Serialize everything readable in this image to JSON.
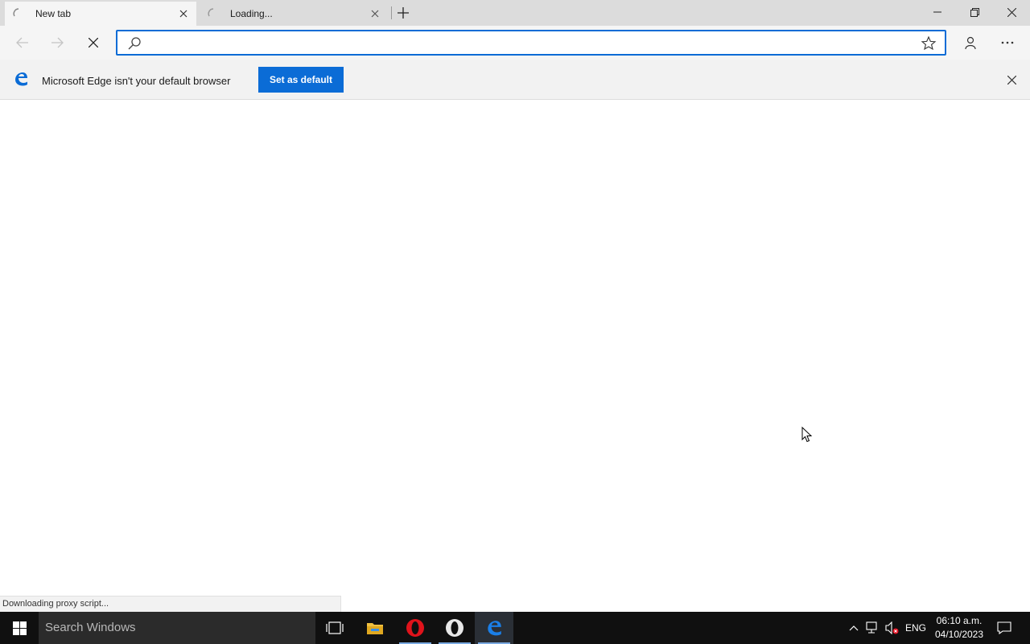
{
  "browser": {
    "tabs": [
      {
        "label": "New tab",
        "active": true
      },
      {
        "label": "Loading...",
        "active": false
      }
    ]
  },
  "address": {
    "value": "",
    "placeholder": ""
  },
  "infobar": {
    "message": "Microsoft Edge isn't your default browser",
    "button_label": "Set as default"
  },
  "status": {
    "text": "Downloading proxy script..."
  },
  "taskbar": {
    "search_placeholder": "Search Windows",
    "apps": [
      "task-view",
      "file-explorer",
      "opera",
      "opera-gx",
      "microsoft-edge"
    ],
    "language": "ENG",
    "time": "06:10 a.m.",
    "date": "04/10/2023"
  },
  "colors": {
    "accent": "#0b6cd6",
    "titlebar": "#dcdcdc",
    "taskbar": "#101010"
  }
}
